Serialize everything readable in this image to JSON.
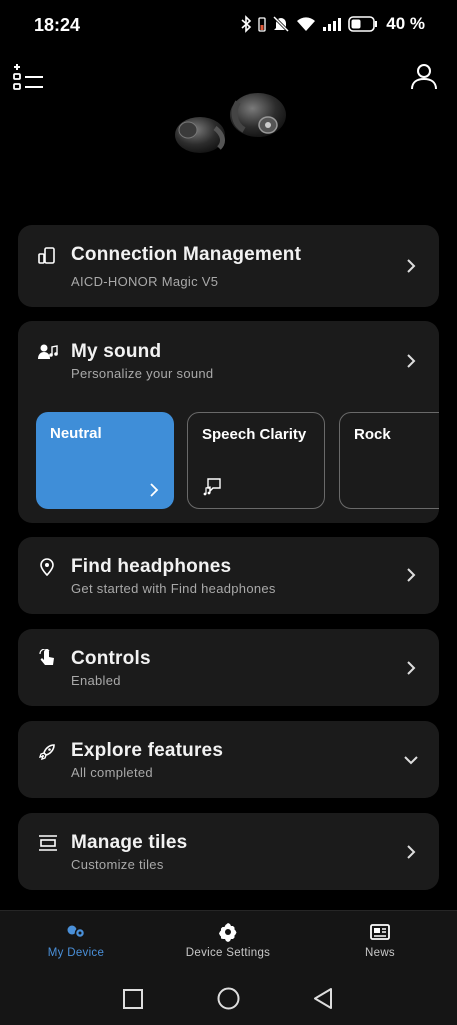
{
  "status_bar": {
    "time": "18:24",
    "battery_percent": "40 %",
    "icons": [
      "bluetooth-icon",
      "battery-saver-icon",
      "mute-icon",
      "wifi-icon",
      "signal-icon",
      "battery-icon"
    ]
  },
  "header": {
    "left_icon": "add-list-icon",
    "right_icon": "profile-icon",
    "hero_image": "earbuds-image"
  },
  "cards": {
    "connection": {
      "title": "Connection Management",
      "subtitle": "AICD-HONOR Magic V5",
      "icon": "phone-connection-icon"
    },
    "my_sound": {
      "title": "My sound",
      "subtitle": "Personalize your sound",
      "icon": "person-music-icon"
    },
    "find": {
      "title": "Find headphones",
      "subtitle": "Get started with Find headphones",
      "icon": "location-pin-icon"
    },
    "controls": {
      "title": "Controls",
      "subtitle": "Enabled",
      "icon": "touch-gesture-icon"
    },
    "explore": {
      "title": "Explore features",
      "subtitle": "All completed",
      "icon": "rocket-icon"
    },
    "tiles": {
      "title": "Manage tiles",
      "subtitle": "Customize tiles",
      "icon": "tiles-icon"
    }
  },
  "sound_presets": [
    {
      "label": "Neutral",
      "selected": true
    },
    {
      "label": "Speech Clarity",
      "selected": false
    },
    {
      "label": "Rock",
      "selected": false
    }
  ],
  "bottom_nav": [
    {
      "label": "My Device",
      "active": true,
      "icon": "earbuds-nav-icon"
    },
    {
      "label": "Device Settings",
      "active": false,
      "icon": "gear-icon"
    },
    {
      "label": "News",
      "active": false,
      "icon": "news-icon"
    }
  ],
  "colors": {
    "accent": "#3f8ed8",
    "card": "#1b1b1b",
    "background": "#000000",
    "nav_active": "#4a90d9"
  }
}
